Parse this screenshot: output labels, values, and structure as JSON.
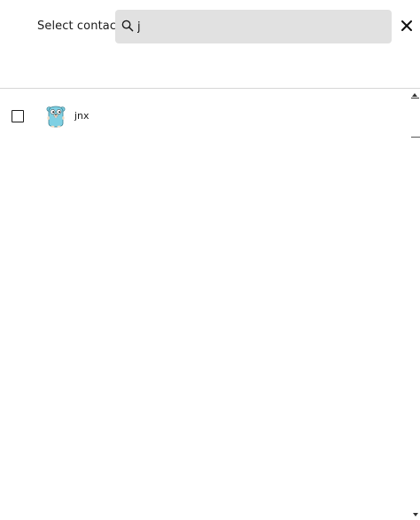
{
  "header": {
    "title": "Select contacts",
    "search": {
      "value": "j",
      "placeholder": "",
      "icon": "search-icon"
    },
    "close_icon": "close-icon"
  },
  "contacts": [
    {
      "name": "jnx",
      "checked": false,
      "avatar_icon": "gopher-avatar-icon"
    }
  ],
  "colors": {
    "search_background": "#e1e1e1",
    "divider": "#d6d6d6",
    "avatar_body": "#7fd0e3",
    "text": "#1a1a1a"
  }
}
